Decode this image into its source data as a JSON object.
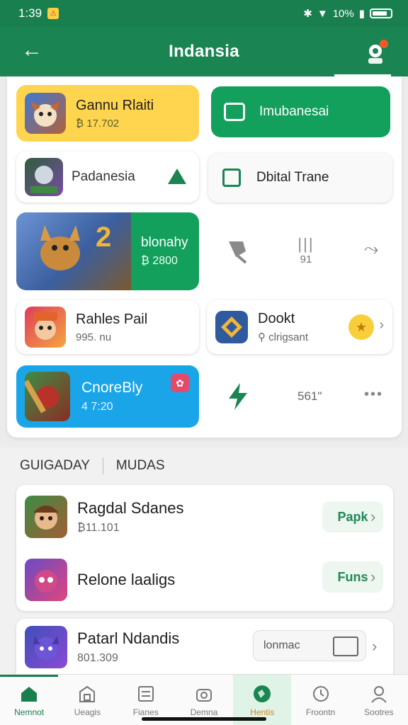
{
  "status": {
    "time": "1:39",
    "battery": "10%"
  },
  "appbar": {
    "title": "Indansia"
  },
  "grid": {
    "tile1": {
      "name": "Gannu Rlaiti",
      "sub": "₿ 17.702"
    },
    "tile2": {
      "name": "Imubanesai"
    },
    "tile3": {
      "name": "Padanesia"
    },
    "tile4": {
      "name": "Dbital Trane"
    },
    "tile5": {
      "name": "blonahy",
      "sub": "₿ 2800"
    },
    "tile5_side": {
      "val": "91"
    },
    "tile6": {
      "name": "Rahles Pail",
      "sub": "995. nu"
    },
    "tile7": {
      "name": "Dookt",
      "sub": "⚲ clrigsant"
    },
    "tile8": {
      "name": "CnoreBly",
      "sub": "4 7:20"
    },
    "tile8_side": {
      "val": "561\""
    }
  },
  "section": {
    "tab1": "GUIGADAY",
    "tab2": "MUDAS"
  },
  "list": [
    {
      "name": "Ragdal Sdanes",
      "sub": "₿11.101",
      "action": "Papk"
    },
    {
      "name": "Relone laaligs",
      "sub": "",
      "action": "Funs"
    },
    {
      "name": "Patarl Ndandis",
      "sub": "801.309",
      "action": "lonmac"
    }
  ],
  "nav": [
    {
      "label": "Nemnot"
    },
    {
      "label": "Ueagis"
    },
    {
      "label": "Fianes"
    },
    {
      "label": "Demna"
    },
    {
      "label": "Hentis"
    },
    {
      "label": "Froontn"
    },
    {
      "label": "Sootres"
    }
  ],
  "colors": {
    "brand": "#1a8553",
    "yellow": "#ffd54f",
    "blue": "#1aa5e8",
    "green": "#12a05c"
  }
}
